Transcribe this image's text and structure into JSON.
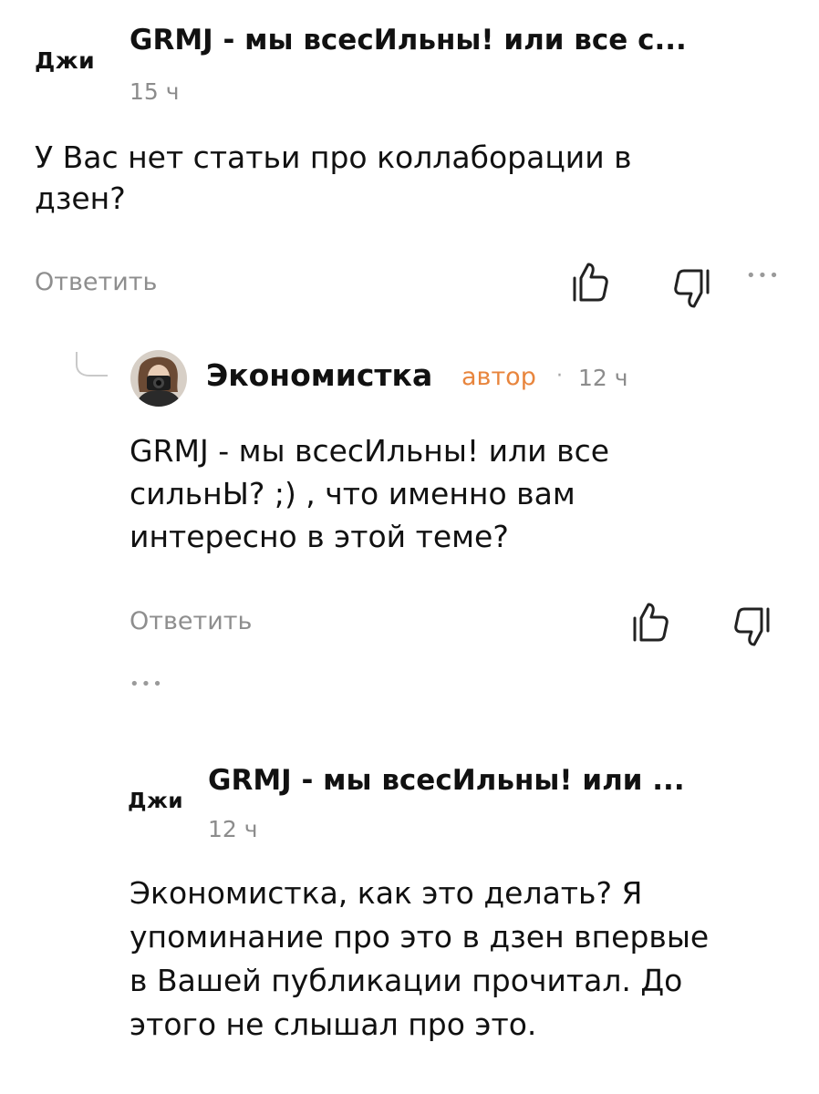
{
  "comments": [
    {
      "avatar_text": "Джи",
      "author": "GRMJ - мы всесИльны! или все с...",
      "time": "15 ч",
      "text_lines": [
        "У Вас нет статьи про коллаборации в",
        "дзен?"
      ],
      "reply_label": "Ответить",
      "more_label": "•••"
    },
    {
      "author": "Экономистка",
      "badge": "автор",
      "separator": "·",
      "time": "12 ч",
      "text_lines": [
        "GRMJ - мы всесИльны! или все",
        "сильнЫ? ;) , что именно вам",
        "интересно в этой теме?"
      ],
      "reply_label": "Ответить",
      "more_label": "•••"
    },
    {
      "avatar_text": "Джи",
      "author": "GRMJ - мы всесИльны! или ...",
      "time": "12 ч",
      "text_lines": [
        "Экономистка, как это делать? Я",
        "упоминание про это в дзен впервые",
        "в Вашей публикации прочитал. До",
        "этого не слышал про это."
      ]
    }
  ],
  "icons": {
    "like": "thumbs-up-icon",
    "dislike": "thumbs-down-icon",
    "thread": "thread-connector-icon",
    "avatar_photo": "avatar-photo"
  },
  "colors": {
    "text": "#111111",
    "muted": "#8e8e8e",
    "author_badge": "#e8853d"
  }
}
